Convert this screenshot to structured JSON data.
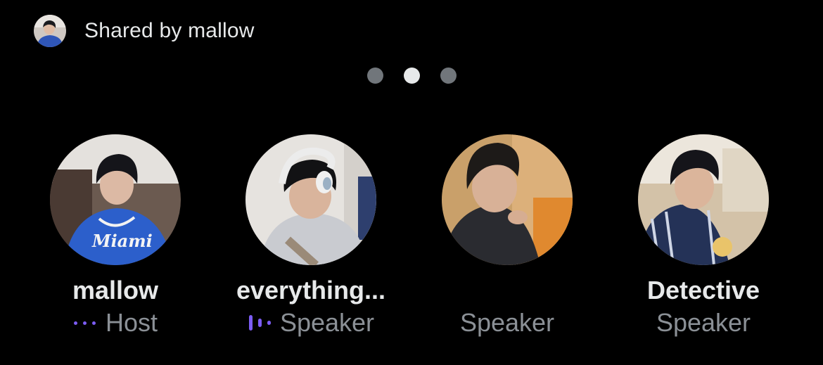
{
  "header": {
    "shared_by_text": "Shared by mallow"
  },
  "pager": {
    "count": 3,
    "active_index": 1
  },
  "participants": [
    {
      "name": "mallow",
      "role": "Host",
      "role_icon": "audio-indicator-dots-icon"
    },
    {
      "name": "everything...",
      "role": "Speaker",
      "role_icon": "audio-indicator-bars-icon"
    },
    {
      "name": "",
      "role": "Speaker",
      "role_icon": ""
    },
    {
      "name": "Detective",
      "role": "Speaker",
      "role_icon": ""
    }
  ],
  "colors": {
    "background": "#000000",
    "text_primary": "#e7e9ea",
    "text_secondary": "#8b9096",
    "audio_indicator": "#7c5cf4",
    "dot_inactive": "#71767b",
    "dot_active": "#e7e9ea"
  }
}
